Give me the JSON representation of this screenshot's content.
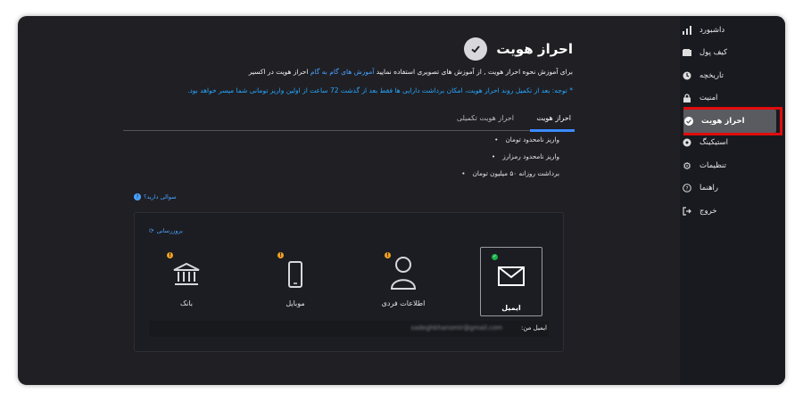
{
  "sidebar": {
    "items": [
      {
        "label": "داشبورد",
        "icon": "bar-chart-icon"
      },
      {
        "label": "کیف پول",
        "icon": "wallet-icon"
      },
      {
        "label": "تاریخچه",
        "icon": "clock-icon"
      },
      {
        "label": "امنیت",
        "icon": "lock-icon"
      },
      {
        "label": "احراز هویت",
        "icon": "check-circle-icon",
        "active": true
      },
      {
        "label": "استیکینگ",
        "icon": "staking-icon"
      },
      {
        "label": "تنظیمات",
        "icon": "gear-icon"
      },
      {
        "label": "راهنما",
        "icon": "help-icon"
      },
      {
        "label": "خروج",
        "icon": "logout-icon"
      }
    ]
  },
  "header": {
    "title": "احراز هویت",
    "intro_prefix": "برای آموزش نحوه احراز هویت , از آموزش های تصویری استفاده نمایید",
    "intro_link": "آموزش های گام به گام",
    "intro_suffix": "احراز هویت در اکسیر",
    "note": "* توجه: بعد از تکمیل روند احراز هویت، امکان برداشت دارایی ها فقط بعد از گذشت 72 ساعت از اولین واریز تومانی شما میسر خواهد بود."
  },
  "tabs": [
    {
      "label": "احراز هویت",
      "active": true
    },
    {
      "label": "احراز هویت تکمیلی",
      "active": false
    }
  ],
  "benefits": [
    "واریز نامحدود تومان",
    "واریز نامحدود رمزارز",
    "برداشت روزانه ۵۰ میلیون تومان"
  ],
  "faq_link": "سوالی دارید؟",
  "card": {
    "refresh_label": "بروزرسانی",
    "tiles": [
      {
        "label": "ایمیل",
        "icon": "envelope-icon",
        "status": "verified"
      },
      {
        "label": "اطلاعات فردی",
        "icon": "person-icon",
        "status": "warning"
      },
      {
        "label": "موبایل",
        "icon": "mobile-icon",
        "status": "warning"
      },
      {
        "label": "بانک",
        "icon": "bank-icon",
        "status": "warning"
      }
    ],
    "email_label": "ایمیل من:",
    "email_value": "sadeghkhanomir@gmail.com"
  },
  "colors": {
    "accent": "#3b8bff",
    "link": "#4aa3ff",
    "highlight": "#e10c0c",
    "verified": "#19b14a",
    "warning": "#f2a020"
  }
}
